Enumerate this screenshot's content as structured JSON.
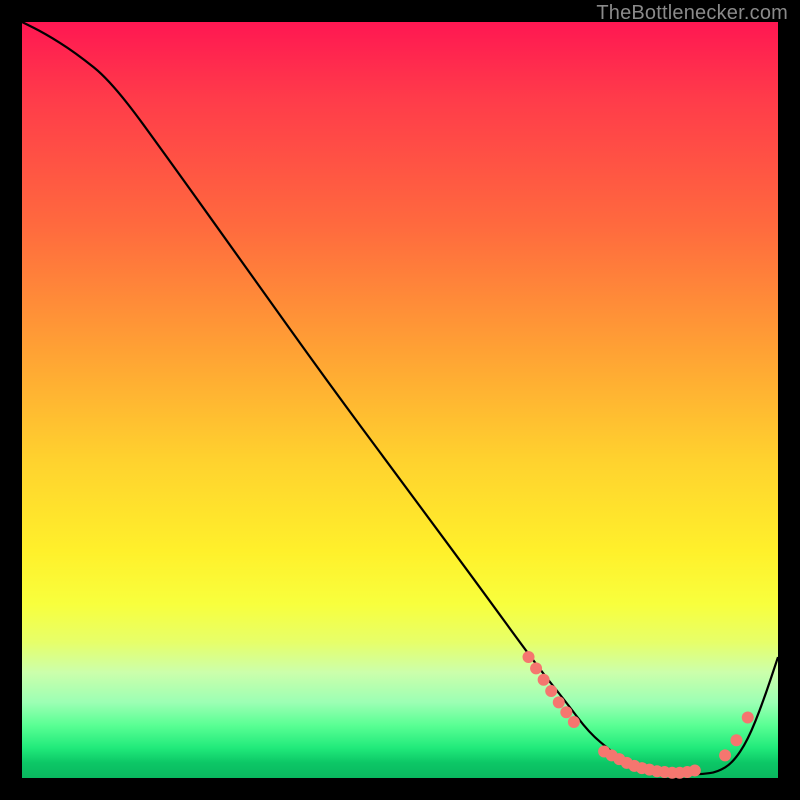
{
  "watermark": {
    "text": "TheBottlenecker.com"
  },
  "chart_data": {
    "type": "line",
    "title": "",
    "xlabel": "",
    "ylabel": "",
    "xlim": [
      0,
      100
    ],
    "ylim": [
      0,
      100
    ],
    "series": [
      {
        "name": "curve",
        "x": [
          0,
          3,
          7,
          12,
          20,
          30,
          40,
          50,
          60,
          68,
          72,
          75,
          78,
          80,
          82,
          84,
          86,
          88,
          90,
          92,
          94,
          96,
          98,
          100
        ],
        "y": [
          100,
          98.5,
          96,
          92,
          81,
          67,
          53,
          39.5,
          26,
          15,
          10,
          6,
          3.5,
          2,
          1.2,
          0.8,
          0.5,
          0.5,
          0.5,
          0.8,
          2,
          5,
          10,
          16
        ]
      }
    ],
    "markers": [
      {
        "series": "curve",
        "cluster": "valley-left",
        "points": [
          {
            "x": 67,
            "y": 16
          },
          {
            "x": 68,
            "y": 14.5
          },
          {
            "x": 69,
            "y": 13
          },
          {
            "x": 70,
            "y": 11.5
          },
          {
            "x": 71,
            "y": 10
          },
          {
            "x": 72,
            "y": 8.7
          },
          {
            "x": 73,
            "y": 7.4
          }
        ]
      },
      {
        "series": "curve",
        "cluster": "valley-floor",
        "points": [
          {
            "x": 77,
            "y": 3.5
          },
          {
            "x": 78,
            "y": 3
          },
          {
            "x": 79,
            "y": 2.5
          },
          {
            "x": 80,
            "y": 2
          },
          {
            "x": 81,
            "y": 1.6
          },
          {
            "x": 82,
            "y": 1.3
          },
          {
            "x": 83,
            "y": 1.1
          },
          {
            "x": 84,
            "y": 0.9
          },
          {
            "x": 85,
            "y": 0.8
          },
          {
            "x": 86,
            "y": 0.7
          },
          {
            "x": 87,
            "y": 0.7
          },
          {
            "x": 88,
            "y": 0.8
          },
          {
            "x": 89,
            "y": 1.0
          }
        ]
      },
      {
        "series": "curve",
        "cluster": "valley-right",
        "points": [
          {
            "x": 93,
            "y": 3
          },
          {
            "x": 94.5,
            "y": 5
          },
          {
            "x": 96,
            "y": 8
          }
        ]
      }
    ],
    "colors": {
      "curve_stroke": "#000000",
      "marker_fill": "#f5766f"
    }
  }
}
